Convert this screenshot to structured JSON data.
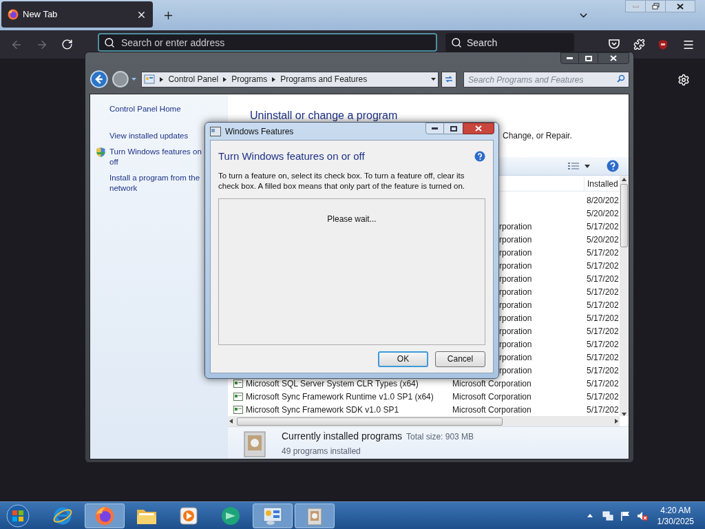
{
  "browser": {
    "tabs": [
      {
        "title": "New Tab",
        "selected": true
      }
    ],
    "nav": {
      "back": {
        "disabled": true
      },
      "forward": {
        "disabled": true
      }
    },
    "address_bar": {
      "placeholder": "Search or enter address"
    },
    "search_bar": {
      "placeholder": "Search"
    }
  },
  "control_panel": {
    "breadcrumb": [
      "Control Panel",
      "Programs",
      "Programs and Features"
    ],
    "search": {
      "placeholder": "Search Programs and Features"
    },
    "sidebar": {
      "items": [
        {
          "kind": "link",
          "lines": [
            "Control Panel Home"
          ]
        },
        {
          "kind": "link",
          "lines": [
            "View installed updates"
          ]
        },
        {
          "kind": "shield",
          "lines": [
            "Turn Windows features on",
            "off"
          ]
        },
        {
          "kind": "link",
          "lines": [
            "Install a program from the",
            "network"
          ]
        }
      ]
    },
    "heading": "Uninstall or change a program",
    "subtext": "Change, or Repair.",
    "table": {
      "columns": [
        {
          "label": "Installed"
        }
      ],
      "rows": [
        {
          "kind": "partial",
          "installed": "8/20/202"
        },
        {
          "kind": "partial",
          "installed": "5/20/202"
        },
        {
          "kind": "partial",
          "publisher": "rporation",
          "installed": "5/17/202"
        },
        {
          "kind": "partial",
          "publisher": "rporation",
          "installed": "5/20/202"
        },
        {
          "kind": "partial",
          "publisher": "rporation",
          "installed": "5/17/202"
        },
        {
          "kind": "partial",
          "publisher": "rporation",
          "installed": "5/17/202"
        },
        {
          "kind": "partial",
          "publisher": "rporation",
          "installed": "5/17/202"
        },
        {
          "kind": "partial",
          "publisher": "rporation",
          "installed": "5/17/202"
        },
        {
          "kind": "partial",
          "publisher": "rporation",
          "installed": "5/17/202"
        },
        {
          "kind": "partial",
          "publisher": "rporation",
          "installed": "5/17/202"
        },
        {
          "kind": "partial",
          "publisher": "rporation",
          "installed": "5/17/202"
        },
        {
          "kind": "partial",
          "publisher": "rporation",
          "installed": "5/17/202"
        },
        {
          "kind": "partial",
          "publisher": "rporation",
          "installed": "5/17/202"
        },
        {
          "kind": "partial",
          "publisher": "rporation",
          "installed": "5/17/202"
        },
        {
          "kind": "full",
          "name": "Microsoft SQL Server System CLR Types (x64)",
          "publisher": "Microsoft Corporation",
          "installed": "5/17/202"
        },
        {
          "kind": "full",
          "name": "Microsoft Sync Framework Runtime v1.0 SP1 (x64)",
          "publisher": "Microsoft Corporation",
          "installed": "5/17/202"
        },
        {
          "kind": "full",
          "name": "Microsoft Sync Framework SDK v1.0 SP1",
          "publisher": "Microsoft Corporation",
          "installed": "5/17/202"
        }
      ]
    },
    "details": {
      "title": "Currently installed programs",
      "total_size": "Total size: 903 MB",
      "count": "49 programs installed"
    }
  },
  "dialog": {
    "title": "Windows Features",
    "heading": "Turn Windows features on or off",
    "description": "To turn a feature on, select its check box. To turn a feature off, clear its check box. A filled box means that only part of the feature is turned on.",
    "status": "Please wait...",
    "buttons": [
      {
        "label": "OK",
        "default": true
      },
      {
        "label": "Cancel",
        "default": false
      }
    ]
  },
  "taskbar": {
    "apps": [
      {
        "kind": "ie",
        "active": false
      },
      {
        "kind": "firefox",
        "active": true
      },
      {
        "kind": "folder",
        "active": false
      },
      {
        "kind": "media",
        "active": false
      },
      {
        "kind": "green",
        "active": false
      },
      {
        "kind": "control",
        "active": true
      },
      {
        "kind": "programs",
        "active": true
      }
    ],
    "clock": {
      "time": "4:20 AM",
      "date": "1/30/2025"
    }
  }
}
